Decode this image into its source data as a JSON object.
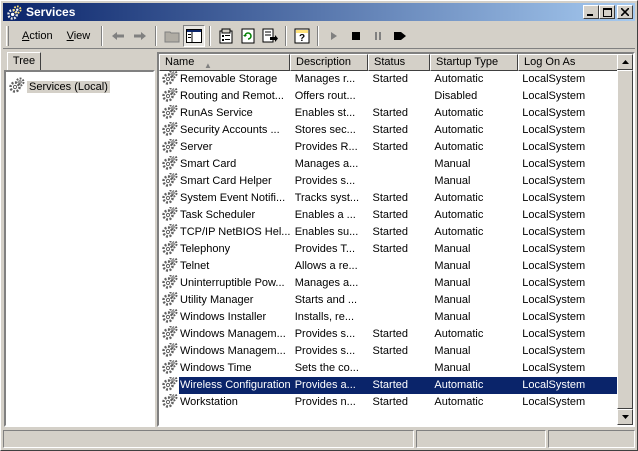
{
  "window": {
    "title": "Services",
    "icon": "services-gear-icon"
  },
  "title_buttons": {
    "minimize": "_",
    "maximize": "□",
    "close": "×"
  },
  "toolbar": {
    "menus": [
      {
        "label": "Action",
        "mnemonic": "A",
        "rest": "ction"
      },
      {
        "label": "View",
        "mnemonic": "V",
        "rest": "iew"
      }
    ],
    "tools": [
      "back-arrow-icon",
      "forward-arrow-icon",
      "up-folder-icon",
      "show-hide-tree-icon",
      "properties-icon",
      "refresh-icon",
      "export-list-icon",
      "help-icon",
      "start-service-icon",
      "stop-service-icon",
      "pause-service-icon",
      "restart-service-icon"
    ]
  },
  "tree": {
    "tab_label": "Tree",
    "root_label": "Services (Local)"
  },
  "list": {
    "columns": [
      "Name",
      "Description",
      "Status",
      "Startup Type",
      "Log On As"
    ],
    "sort_column": "Name",
    "selected_row": "Wireless Configuration",
    "rows": [
      {
        "name": "Removable Storage",
        "description": "Manages r...",
        "status": "Started",
        "startup": "Automatic",
        "logon": "LocalSystem"
      },
      {
        "name": "Routing and Remot...",
        "description": "Offers rout...",
        "status": "",
        "startup": "Disabled",
        "logon": "LocalSystem"
      },
      {
        "name": "RunAs Service",
        "description": "Enables st...",
        "status": "Started",
        "startup": "Automatic",
        "logon": "LocalSystem"
      },
      {
        "name": "Security Accounts ...",
        "description": "Stores sec...",
        "status": "Started",
        "startup": "Automatic",
        "logon": "LocalSystem"
      },
      {
        "name": "Server",
        "description": "Provides R...",
        "status": "Started",
        "startup": "Automatic",
        "logon": "LocalSystem"
      },
      {
        "name": "Smart Card",
        "description": "Manages a...",
        "status": "",
        "startup": "Manual",
        "logon": "LocalSystem"
      },
      {
        "name": "Smart Card Helper",
        "description": "Provides s...",
        "status": "",
        "startup": "Manual",
        "logon": "LocalSystem"
      },
      {
        "name": "System Event Notifi...",
        "description": "Tracks syst...",
        "status": "Started",
        "startup": "Automatic",
        "logon": "LocalSystem"
      },
      {
        "name": "Task Scheduler",
        "description": "Enables a ...",
        "status": "Started",
        "startup": "Automatic",
        "logon": "LocalSystem"
      },
      {
        "name": "TCP/IP NetBIOS Hel...",
        "description": "Enables su...",
        "status": "Started",
        "startup": "Automatic",
        "logon": "LocalSystem"
      },
      {
        "name": "Telephony",
        "description": "Provides T...",
        "status": "Started",
        "startup": "Manual",
        "logon": "LocalSystem"
      },
      {
        "name": "Telnet",
        "description": "Allows a re...",
        "status": "",
        "startup": "Manual",
        "logon": "LocalSystem"
      },
      {
        "name": "Uninterruptible Pow...",
        "description": "Manages a...",
        "status": "",
        "startup": "Manual",
        "logon": "LocalSystem"
      },
      {
        "name": "Utility Manager",
        "description": "Starts and ...",
        "status": "",
        "startup": "Manual",
        "logon": "LocalSystem"
      },
      {
        "name": "Windows Installer",
        "description": "Installs, re...",
        "status": "",
        "startup": "Manual",
        "logon": "LocalSystem"
      },
      {
        "name": "Windows Managem...",
        "description": "Provides s...",
        "status": "Started",
        "startup": "Automatic",
        "logon": "LocalSystem"
      },
      {
        "name": "Windows Managem...",
        "description": "Provides s...",
        "status": "Started",
        "startup": "Manual",
        "logon": "LocalSystem"
      },
      {
        "name": "Windows Time",
        "description": "Sets the co...",
        "status": "",
        "startup": "Manual",
        "logon": "LocalSystem"
      },
      {
        "name": "Wireless Configuration",
        "description": "Provides a...",
        "status": "Started",
        "startup": "Automatic",
        "logon": "LocalSystem"
      },
      {
        "name": "Workstation",
        "description": "Provides n...",
        "status": "Started",
        "startup": "Automatic",
        "logon": "LocalSystem"
      }
    ]
  },
  "colors": {
    "title_active": "#0a246a",
    "title_gradient_end": "#a6caf0",
    "selection": "#0a246a",
    "face": "#d4d0c8"
  }
}
